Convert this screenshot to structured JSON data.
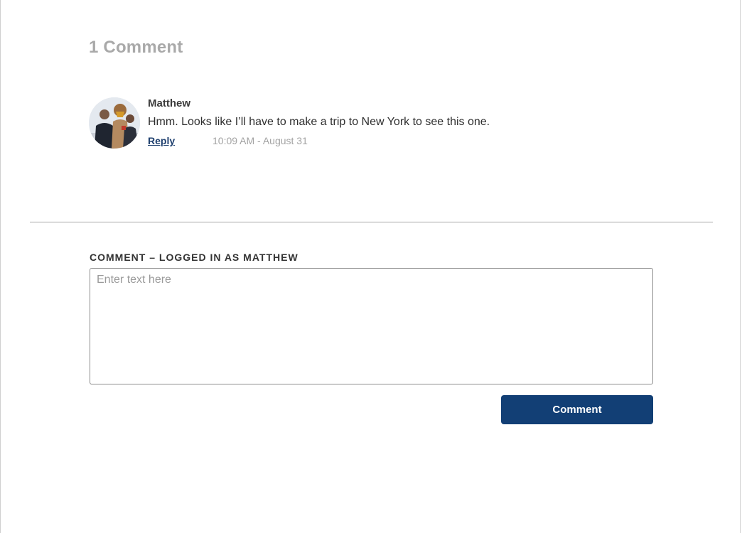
{
  "comments_section": {
    "count_label": "1 Comment",
    "comments": [
      {
        "author": "Matthew",
        "text": "Hmm. Looks like I’ll have to make a trip to New York to see this one.",
        "reply_label": "Reply",
        "timestamp": "10:09 AM - August 31",
        "avatar_icon": "user-avatar-photo"
      }
    ]
  },
  "comment_form": {
    "label": "COMMENT – LOGGED IN AS MATTHEW",
    "placeholder": "Enter text here",
    "value": "",
    "submit_label": "Comment"
  },
  "colors": {
    "accent": "#123f75",
    "link": "#1e3f6e",
    "muted_text": "#a9a9a9",
    "divider": "#a8a8a8"
  }
}
